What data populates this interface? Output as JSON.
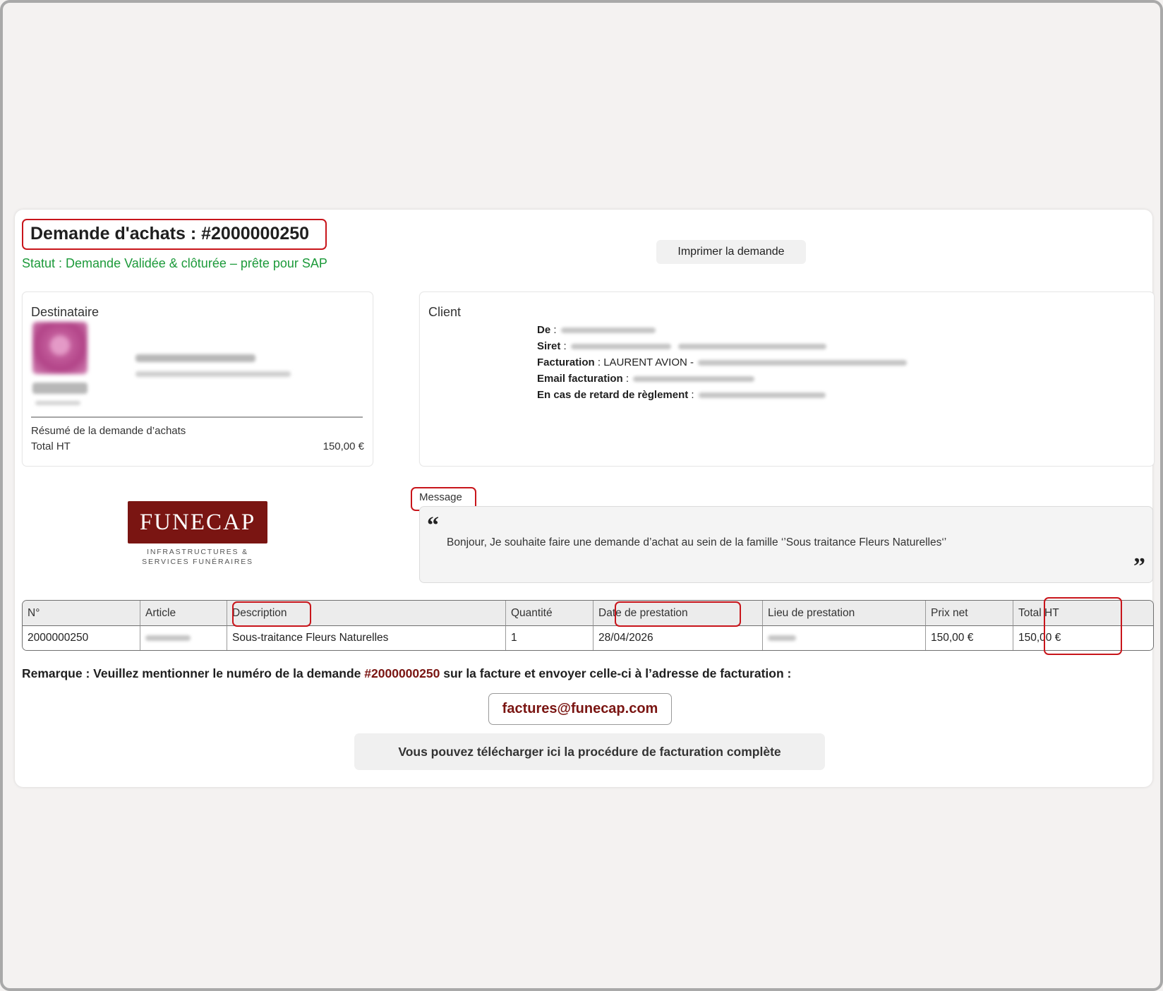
{
  "header": {
    "title": "Demande d'achats : #2000000250",
    "status": "Statut : Demande Validée & clôturée – prête pour SAP",
    "print_button": "Imprimer la demande"
  },
  "destinataire": {
    "heading": "Destinataire",
    "summary_label": "Résumé de la demande d’achats",
    "total_label": "Total HT",
    "total_value": "150,00 €"
  },
  "client": {
    "heading": "Client",
    "de_label": "De",
    "siret_label": "Siret",
    "facturation_label": "Facturation",
    "facturation_value": "LAURENT AVION",
    "email_label": "Email facturation",
    "retard_label": "En cas de retard de règlement"
  },
  "logo": {
    "name": "FUNECAP",
    "tagline_1": "INFRASTRUCTURES &",
    "tagline_2": "SERVICES FUNÉRAIRES"
  },
  "message": {
    "label": "Message",
    "text": "Bonjour, Je souhaite faire une demande d’achat au sein de la famille ‘’Sous traitance Fleurs Naturelles‘’",
    "open_quote": "“",
    "close_quote": "”"
  },
  "table": {
    "columns": [
      "N°",
      "Article",
      "Description",
      "Quantité",
      "Date de prestation",
      "Lieu de prestation",
      "Prix net",
      "Total HT"
    ],
    "rows": [
      {
        "numero": "2000000250",
        "description": "Sous-traitance Fleurs Naturelles",
        "quantite": "1",
        "date": "28/04/2026",
        "prix_net": "150,00 €",
        "total_ht": "150,00 €"
      }
    ]
  },
  "footer": {
    "remark_prefix": "Remarque : Veuillez mentionner le numéro de la demande",
    "remark_number": "#2000000250",
    "remark_suffix": "sur la facture et envoyer celle-ci à l’adresse de facturation :",
    "email": "factures@funecap.com",
    "download_button": "Vous pouvez télécharger ici la procédure de facturation complète"
  },
  "colors": {
    "status_green": "#1c9a3a",
    "brand_red": "#7a1512",
    "highlight_red": "#c8151b"
  }
}
